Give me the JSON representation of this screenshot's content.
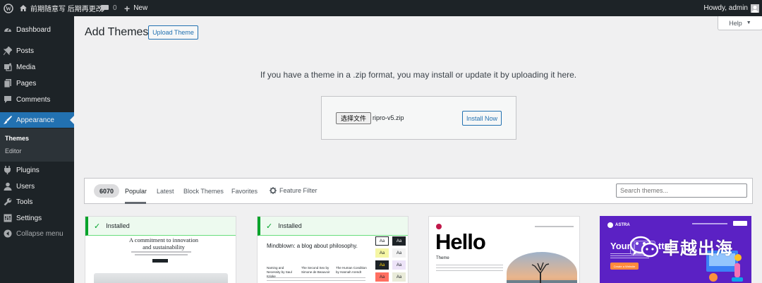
{
  "admin_bar": {
    "site_name": "前期随意写 后期再更改",
    "comments_count": "0",
    "new_label": "New",
    "howdy": "Howdy, admin"
  },
  "sidebar": {
    "items": [
      {
        "label": "Dashboard",
        "icon": "dashboard-icon"
      },
      {
        "label": "Posts",
        "icon": "pin-icon"
      },
      {
        "label": "Media",
        "icon": "media-icon"
      },
      {
        "label": "Pages",
        "icon": "pages-icon"
      },
      {
        "label": "Comments",
        "icon": "comment-icon"
      },
      {
        "label": "Appearance",
        "icon": "brush-icon"
      },
      {
        "label": "Plugins",
        "icon": "plug-icon"
      },
      {
        "label": "Users",
        "icon": "users-icon"
      },
      {
        "label": "Tools",
        "icon": "wrench-icon"
      },
      {
        "label": "Settings",
        "icon": "settings-icon"
      },
      {
        "label": "Collapse menu",
        "icon": "collapse-icon"
      }
    ],
    "submenu": [
      "Themes",
      "Editor"
    ]
  },
  "header": {
    "title": "Add Themes",
    "upload_button": "Upload Theme",
    "help": "Help"
  },
  "upload": {
    "instruction": "If you have a theme in a .zip format, you may install or update it by uploading it here.",
    "choose_file": "选择文件",
    "file_name": "ripro-v5.zip",
    "install_button": "Install Now"
  },
  "filter": {
    "count": "6070",
    "tabs": [
      "Popular",
      "Latest",
      "Block Themes",
      "Favorites"
    ],
    "feature_filter": "Feature Filter",
    "search_placeholder": "Search themes..."
  },
  "themes": {
    "installed_label": "Installed",
    "card1": {
      "headline": "A commitment to innovation and sustainability"
    },
    "card2": {
      "headline": "Mindblown: a blog about philosophy.",
      "posts": [
        "Naming and Necessity by Saul Kripke",
        "The Second Sex by Simone de Beauvoir",
        "The Human Condition by Hannah Arendt"
      ],
      "swatch_label": "Aa"
    },
    "card3": {
      "headline": "Hello",
      "sub": "Theme"
    },
    "card4": {
      "brand": "ASTRA",
      "headline": "Your i",
      "headline_tail": "tter",
      "button": "Create a Website"
    }
  },
  "watermark": "卓越出海",
  "colors": {
    "admin_dark": "#1d2327",
    "accent": "#2271b1",
    "installed_green": "#00a32a",
    "astra_purple": "#5b21c4"
  }
}
